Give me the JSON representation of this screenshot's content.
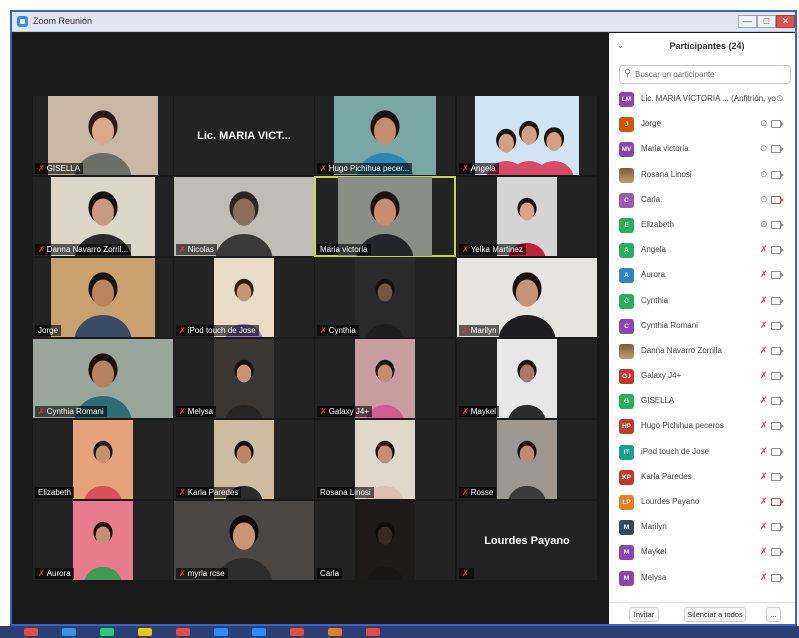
{
  "window": {
    "title": "Zoom Reunión",
    "minimize": "—",
    "maximize": "□",
    "close": "✕"
  },
  "colors": {
    "accent": "#3b63c4",
    "active_speaker": "#c6d83a",
    "muted": "#d94848"
  },
  "gallery": {
    "tiles": [
      {
        "name": "GISELLA",
        "muted": true,
        "type": "video",
        "wall": "#c7b7a3",
        "skin": "#d9a98a",
        "hair": "#2a1c14",
        "shirt": "#6b6f66",
        "vw": 110
      },
      {
        "name": "",
        "label": "Lic. MARIA VICT...",
        "muted": false,
        "type": "name"
      },
      {
        "name": "Hugo Pichihua pecer...",
        "muted": true,
        "type": "video",
        "wall": "#7aa7a3",
        "skin": "#c38d6b",
        "hair": "#1b120d",
        "shirt": "#2f86b4",
        "vw": 102
      },
      {
        "name": "Angela",
        "muted": true,
        "type": "video",
        "wall": "#cfe3f1",
        "skin": "#d4a084",
        "hair": "#1c140f",
        "shirt": "#d94a69",
        "vw": 104,
        "group": true
      },
      {
        "name": "Danna Navarro Zorril...",
        "muted": true,
        "type": "video",
        "wall": "#dcd6c9",
        "skin": "#c99980",
        "hair": "#15100c",
        "shirt": "#2b2b2b",
        "vw": 104
      },
      {
        "name": "Nicolas",
        "muted": true,
        "type": "video",
        "wall": "#c0bcb6",
        "skin": "#8a6e5c",
        "hair": "#2d2520",
        "shirt": "#3a3a3a",
        "vw": 140
      },
      {
        "name": "Maria victoria",
        "muted": false,
        "type": "video",
        "wall": "#8a8e86",
        "skin": "#c68e6e",
        "hair": "#1b130e",
        "shirt": "#23252b",
        "vw": 94,
        "active": true
      },
      {
        "name": "Yelka Martinez",
        "muted": true,
        "type": "video",
        "wall": "#d4d4d4",
        "skin": "#d9a38a",
        "hair": "#1a1210",
        "shirt": "#c8213a",
        "vw": 60
      },
      {
        "name": "Jorge",
        "muted": false,
        "type": "video",
        "wall": "#c9a16e",
        "skin": "#b98561",
        "hair": "#1a120c",
        "shirt": "#3a4b66",
        "vw": 104
      },
      {
        "name": "iPod touch de Jose",
        "muted": true,
        "type": "video",
        "wall": "#e9dcc7",
        "skin": "#c69479",
        "hair": "#2b1c12",
        "shirt": "#9e7bc8",
        "vw": 60
      },
      {
        "name": "Cynthia",
        "muted": true,
        "type": "video",
        "wall": "#2a2a2a",
        "skin": "#6e5848",
        "hair": "#14100d",
        "shirt": "#1f1f1f",
        "vw": 60
      },
      {
        "name": "Marilyn",
        "muted": true,
        "type": "video",
        "wall": "#e6e4e1",
        "skin": "#c79477",
        "hair": "#1a120d",
        "shirt": "#1f1f22",
        "vw": 140
      },
      {
        "name": "Cynthia Romani",
        "muted": true,
        "type": "video",
        "wall": "#9aa59c",
        "skin": "#b98062",
        "hair": "#1a110c",
        "shirt": "#2f6c73",
        "vw": 140
      },
      {
        "name": "Melysa",
        "muted": true,
        "type": "video",
        "wall": "#3b3735",
        "skin": "#c9937a",
        "hair": "#140f0c",
        "shirt": "#262626",
        "vw": 60
      },
      {
        "name": "Galaxy J4+",
        "muted": true,
        "type": "video",
        "wall": "#c89da0",
        "skin": "#c48c73",
        "hair": "#17100c",
        "shirt": "#d35b8f",
        "vw": 60
      },
      {
        "name": "Maykel",
        "muted": true,
        "type": "video",
        "wall": "#e7e7e7",
        "skin": "#a8786a",
        "hair": "#17100c",
        "shirt": "#2a2a2a",
        "vw": 60
      },
      {
        "name": "Elizabeth",
        "muted": false,
        "type": "video",
        "wall": "#e6a37b",
        "skin": "#c89072",
        "hair": "#1d130e",
        "shirt": "#d94f5b",
        "vw": 60
      },
      {
        "name": "Karla Paredes",
        "muted": true,
        "type": "video",
        "wall": "#cdbca2",
        "skin": "#b98767",
        "hair": "#120d09",
        "shirt": "#2c2c2c",
        "vw": 60
      },
      {
        "name": "Rosana Linosi",
        "muted": false,
        "type": "video",
        "wall": "#e1d8cc",
        "skin": "#c48f74",
        "hair": "#1a120d",
        "shirt": "#d9c1b4",
        "vw": 60
      },
      {
        "name": "Rosse",
        "muted": true,
        "type": "video",
        "wall": "#9d9792",
        "skin": "#bd8d75",
        "hair": "#15100d",
        "shirt": "#3a3a3a",
        "vw": 60
      },
      {
        "name": "Aurora",
        "muted": true,
        "type": "video",
        "wall": "#e87b8d",
        "skin": "#c98d74",
        "hair": "#17100c",
        "shirt": "#3f9b58",
        "vw": 60
      },
      {
        "name": "myrla rcse",
        "muted": true,
        "type": "video",
        "wall": "#4a4744",
        "skin": "#c99478",
        "hair": "#120c09",
        "shirt": "#2d2d2d",
        "vw": 140
      },
      {
        "name": "Carla",
        "muted": false,
        "type": "video",
        "wall": "#1f1a1a",
        "skin": "#3a2a26",
        "hair": "#110b09",
        "shirt": "#1a1616",
        "vw": 60
      },
      {
        "name": "",
        "label": "Lourdes Payano",
        "muted": true,
        "type": "name"
      }
    ]
  },
  "participants": {
    "title": "Participantes (24)",
    "search_placeholder": "Buscar un participante",
    "invite": "Invitar",
    "mute_all": "Silenciar a todos",
    "more": "...",
    "list": [
      {
        "initials": "LM",
        "name": "Lic. MARIA VICTORIA ... (Anfitrión, yo)",
        "color": "#8e44ad",
        "mic": "on",
        "cam": "none"
      },
      {
        "initials": "J",
        "name": "Jorge",
        "color": "#d35400",
        "mic": "on",
        "cam": "on"
      },
      {
        "initials": "MV",
        "name": "Maria victoria",
        "color": "#8e44ad",
        "mic": "on",
        "cam": "on"
      },
      {
        "initials": "",
        "name": "Rosana Linosi",
        "color": "photo",
        "mic": "on",
        "cam": "on"
      },
      {
        "initials": "C",
        "name": "Carla",
        "color": "#9b59b6",
        "mic": "on",
        "cam": "off"
      },
      {
        "initials": "E",
        "name": "Elizabeth",
        "color": "#27ae60",
        "mic": "on",
        "cam": "on"
      },
      {
        "initials": "A",
        "name": "Angela",
        "color": "#27ae60",
        "mic": "off",
        "cam": "on"
      },
      {
        "initials": "A",
        "name": "Aurora",
        "color": "#2e86c1",
        "mic": "off",
        "cam": "on"
      },
      {
        "initials": "C",
        "name": "Cynthia",
        "color": "#27ae60",
        "mic": "off",
        "cam": "on"
      },
      {
        "initials": "C",
        "name": "Cynthia Romani",
        "color": "#8e44ad",
        "mic": "off",
        "cam": "on"
      },
      {
        "initials": "",
        "name": "Danna Navarro Zorrilla",
        "color": "photo",
        "mic": "off",
        "cam": "on"
      },
      {
        "initials": "GJ",
        "name": "Galaxy J4+",
        "color": "#c0392b",
        "mic": "off",
        "cam": "on"
      },
      {
        "initials": "G",
        "name": "GISELLA",
        "color": "#27ae60",
        "mic": "off",
        "cam": "on"
      },
      {
        "initials": "HP",
        "name": "Hugo Pichihua peceros",
        "color": "#c0392b",
        "mic": "off",
        "cam": "on"
      },
      {
        "initials": "IT",
        "name": "iPod touch de Jose",
        "color": "#16a085",
        "mic": "off",
        "cam": "on"
      },
      {
        "initials": "KP",
        "name": "Karla Paredes",
        "color": "#c0392b",
        "mic": "off",
        "cam": "on"
      },
      {
        "initials": "LP",
        "name": "Lourdes Payano",
        "color": "#e67e22",
        "mic": "off",
        "cam": "off"
      },
      {
        "initials": "M",
        "name": "Marilyn",
        "color": "#34495e",
        "mic": "off",
        "cam": "on"
      },
      {
        "initials": "M",
        "name": "Maykel",
        "color": "#8e44ad",
        "mic": "off",
        "cam": "on"
      },
      {
        "initials": "M",
        "name": "Melysa",
        "color": "#8e44ad",
        "mic": "off",
        "cam": "on"
      }
    ]
  },
  "taskbar": {
    "icons": [
      "#e74c3c",
      "#3498db",
      "#2ecc71",
      "#f1c40f",
      "#e74c3c",
      "#2d8cff",
      "#2d8cff",
      "#e74c3c",
      "#e67e22",
      "#e74c3c"
    ]
  }
}
